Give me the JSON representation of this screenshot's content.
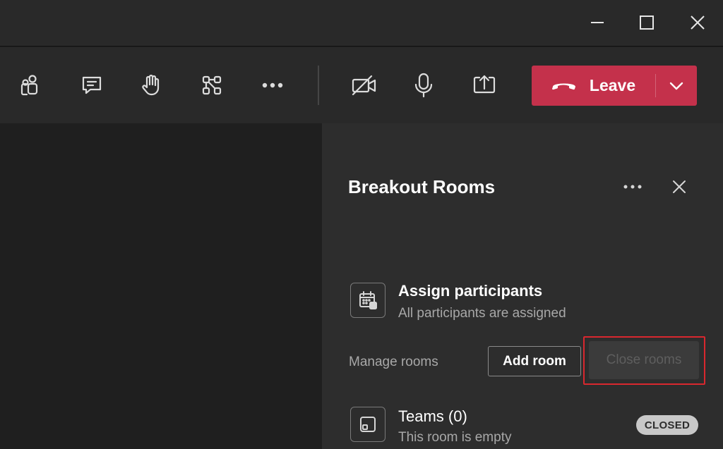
{
  "window": {
    "icons": [
      "minimize-icon",
      "maximize-icon",
      "close-icon"
    ]
  },
  "toolbar": {
    "icons": [
      "people-icon",
      "chat-icon",
      "raise-hand-icon",
      "breakout-rooms-icon",
      "more-options-icon",
      "camera-off-icon",
      "microphone-icon",
      "share-screen-icon"
    ],
    "leave_label": "Leave",
    "leave_color": "#c4314b"
  },
  "panel": {
    "title": "Breakout Rooms",
    "assign": {
      "title": "Assign participants",
      "subtitle": "All participants are assigned"
    },
    "manage": {
      "label": "Manage rooms",
      "add_room": "Add room",
      "close_rooms": "Close rooms",
      "highlight_color": "#d9272e"
    },
    "rooms": [
      {
        "name": "Teams (0)",
        "status_text": "This room is empty",
        "badge": "CLOSED"
      }
    ]
  }
}
